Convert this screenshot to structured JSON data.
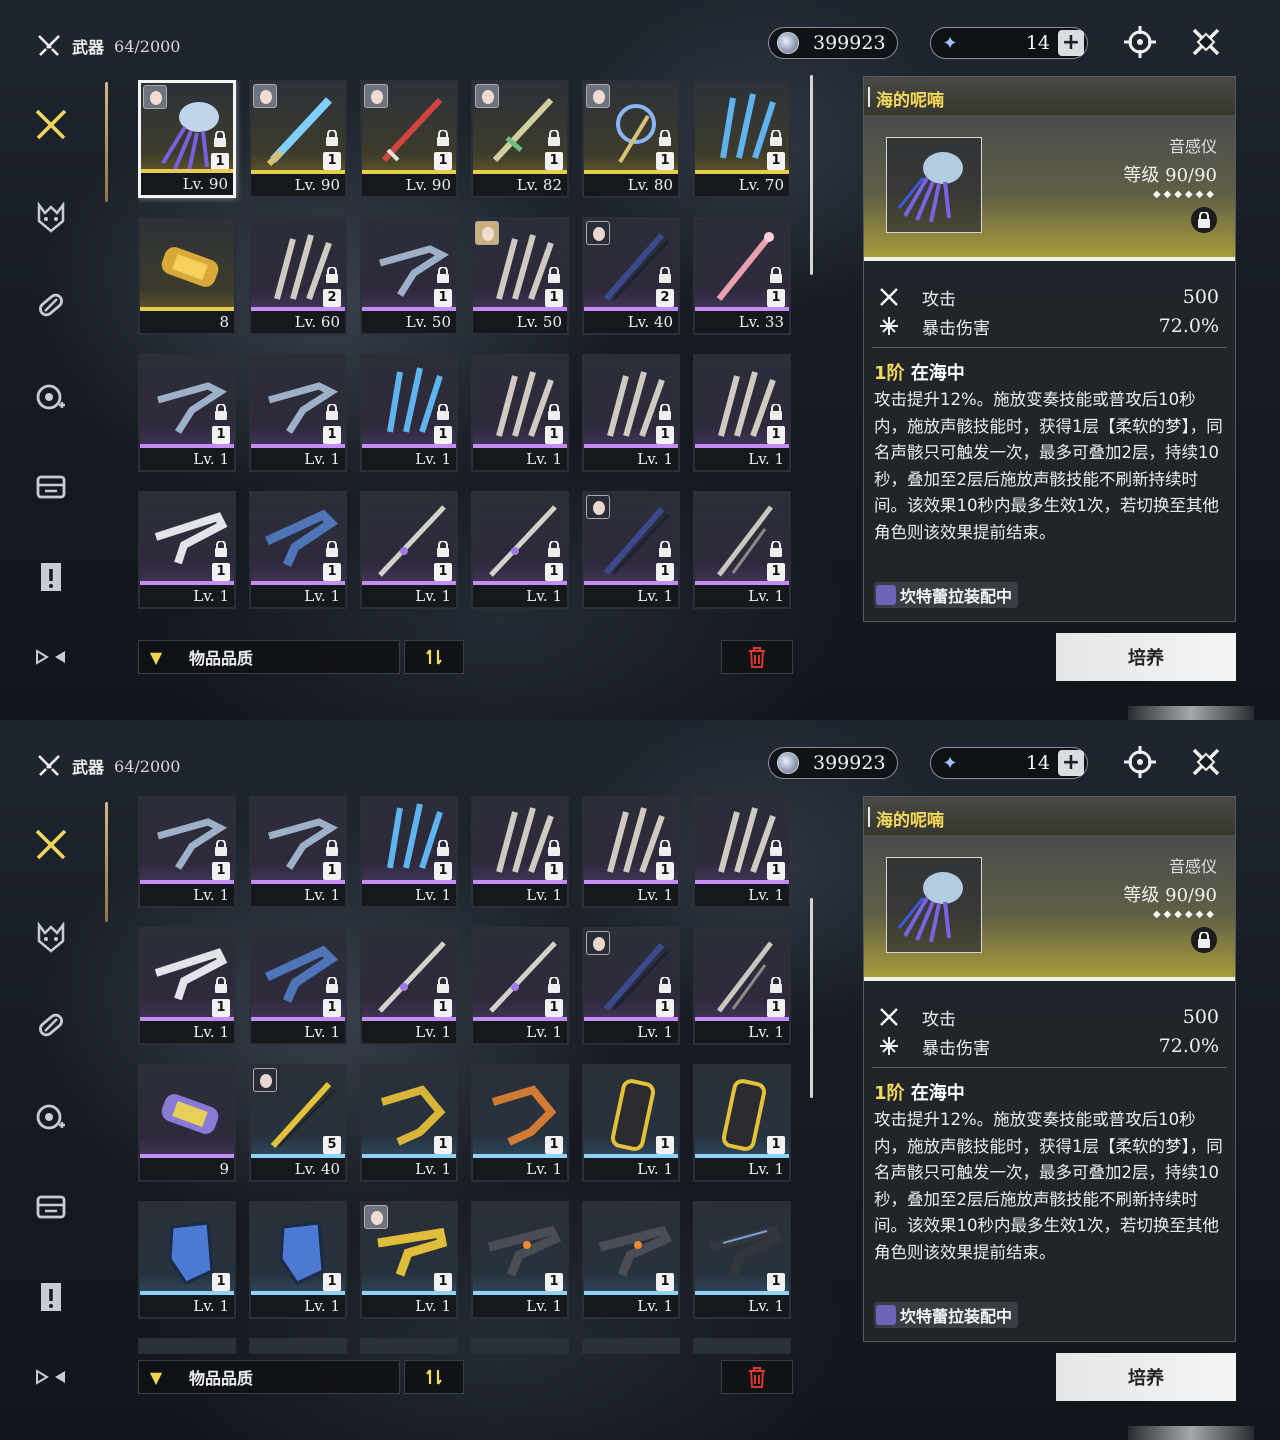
{
  "header": {
    "title": "武器",
    "count": "64/2000",
    "currency_shell": "399923",
    "currency_tide": "14"
  },
  "filter": {
    "label": "物品品质"
  },
  "detail": {
    "name": "海的呢喃",
    "type": "音感仪",
    "level_label": "等级",
    "level_value": "90/90",
    "stars": "◆◆◆◆◆◆",
    "stats": [
      {
        "label": "攻击",
        "value": "500"
      },
      {
        "label": "暴击伤害",
        "value": "72.0%"
      }
    ],
    "skill_rank": "1阶",
    "skill_name": "在海中",
    "skill_desc": "攻击提升12%。施放变奏技能或普攻后10秒内，施放声骸技能时，获得1层【柔软的梦】，同名声骸只可触发一次，最多可叠加2层，持续10秒，叠加至2层后施放声骸技能不刷新持续时间。该效果10秒内最多生效1次，若切换至其他角色则该效果提前结束。",
    "equipped": "坎特蕾拉装配中",
    "cultivate_label": "培养"
  },
  "colors": {
    "gold": "#e7cc52",
    "purple": "#c68cf5",
    "blue": "#8fd3f8",
    "accent_yellow": "#f4d85c"
  },
  "sidebar_icons": [
    "weapon-icon",
    "echo-icon",
    "material-icon",
    "development-icon",
    "resource-icon",
    "quest-item-icon",
    "special-icon"
  ],
  "screen1_rows": [
    [
      {
        "lv": "Lv. 90",
        "count": "1",
        "rarity": "gold",
        "art": "jellyfish",
        "owner": "purple",
        "locked": true,
        "selected": true
      },
      {
        "lv": "Lv. 90",
        "count": "1",
        "rarity": "gold",
        "art": "sword-blue",
        "owner": "silver",
        "locked": true
      },
      {
        "lv": "Lv. 90",
        "count": "1",
        "rarity": "gold",
        "art": "sword-red",
        "owner": "silver",
        "locked": true
      },
      {
        "lv": "Lv. 82",
        "count": "1",
        "rarity": "gold",
        "art": "sword-green",
        "owner": "silver",
        "locked": true
      },
      {
        "lv": "Lv. 80",
        "count": "1",
        "rarity": "gold",
        "art": "staff-blue",
        "owner": "silver",
        "locked": true
      },
      {
        "lv": "Lv. 70",
        "count": "1",
        "rarity": "gold",
        "art": "claw-blue",
        "locked": true
      }
    ],
    [
      {
        "lv": "8",
        "rarity": "gold",
        "art": "canister-gold"
      },
      {
        "lv": "Lv. 60",
        "count": "2",
        "rarity": "purple",
        "art": "blades-silver",
        "locked": true
      },
      {
        "lv": "Lv. 50",
        "count": "1",
        "rarity": "purple",
        "art": "gun-dark",
        "locked": true
      },
      {
        "lv": "Lv. 50",
        "count": "1",
        "rarity": "purple",
        "art": "blades-silver",
        "owner": "blonde",
        "locked": true
      },
      {
        "lv": "Lv. 40",
        "count": "2",
        "rarity": "purple",
        "art": "sword-dark",
        "owner": "dark",
        "locked": true
      },
      {
        "lv": "Lv. 33",
        "count": "1",
        "rarity": "purple",
        "art": "sword-pink",
        "locked": true
      }
    ],
    [
      {
        "lv": "Lv. 1",
        "count": "1",
        "rarity": "purple",
        "art": "gun-dark",
        "locked": true
      },
      {
        "lv": "Lv. 1",
        "count": "1",
        "rarity": "purple",
        "art": "gun-dark",
        "locked": true
      },
      {
        "lv": "Lv. 1",
        "count": "1",
        "rarity": "purple",
        "art": "claw-blue",
        "locked": true
      },
      {
        "lv": "Lv. 1",
        "count": "1",
        "rarity": "purple",
        "art": "blades-silver",
        "locked": true
      },
      {
        "lv": "Lv. 1",
        "count": "1",
        "rarity": "purple",
        "art": "blades-silver",
        "locked": true
      },
      {
        "lv": "Lv. 1",
        "count": "1",
        "rarity": "purple",
        "art": "blades-silver",
        "locked": true
      }
    ],
    [
      {
        "lv": "Lv. 1",
        "count": "1",
        "rarity": "purple",
        "art": "pistol-white",
        "locked": true
      },
      {
        "lv": "Lv. 1",
        "count": "1",
        "rarity": "purple",
        "art": "pistol-blue",
        "locked": true
      },
      {
        "lv": "Lv. 1",
        "count": "1",
        "rarity": "purple",
        "art": "sword-long",
        "locked": true
      },
      {
        "lv": "Lv. 1",
        "count": "1",
        "rarity": "purple",
        "art": "sword-long",
        "locked": true
      },
      {
        "lv": "Lv. 1",
        "count": "1",
        "rarity": "purple",
        "art": "sword-dark",
        "owner": "dark",
        "locked": true
      },
      {
        "lv": "Lv. 1",
        "count": "1",
        "rarity": "purple",
        "art": "spear",
        "locked": true
      }
    ]
  ],
  "screen2_rows": [
    [
      {
        "lv": "Lv. 1",
        "count": "1",
        "rarity": "purple",
        "art": "gun-dark",
        "locked": true
      },
      {
        "lv": "Lv. 1",
        "count": "1",
        "rarity": "purple",
        "art": "gun-dark",
        "locked": true
      },
      {
        "lv": "Lv. 1",
        "count": "1",
        "rarity": "purple",
        "art": "claw-blue",
        "locked": true
      },
      {
        "lv": "Lv. 1",
        "count": "1",
        "rarity": "purple",
        "art": "blades-silver",
        "locked": true
      },
      {
        "lv": "Lv. 1",
        "count": "1",
        "rarity": "purple",
        "art": "blades-silver",
        "locked": true
      },
      {
        "lv": "Lv. 1",
        "count": "1",
        "rarity": "purple",
        "art": "blades-silver",
        "locked": true
      }
    ],
    [
      {
        "lv": "Lv. 1",
        "count": "1",
        "rarity": "purple",
        "art": "pistol-white",
        "locked": true
      },
      {
        "lv": "Lv. 1",
        "count": "1",
        "rarity": "purple",
        "art": "pistol-blue",
        "locked": true
      },
      {
        "lv": "Lv. 1",
        "count": "1",
        "rarity": "purple",
        "art": "sword-long",
        "locked": true
      },
      {
        "lv": "Lv. 1",
        "count": "1",
        "rarity": "purple",
        "art": "sword-long",
        "locked": true
      },
      {
        "lv": "Lv. 1",
        "count": "1",
        "rarity": "purple",
        "art": "sword-dark",
        "owner": "dark",
        "locked": true
      },
      {
        "lv": "Lv. 1",
        "count": "1",
        "rarity": "purple",
        "art": "spear",
        "locked": true
      }
    ],
    [
      {
        "lv": "9",
        "rarity": "purple",
        "art": "canister-purple"
      },
      {
        "lv": "Lv. 40",
        "count": "5",
        "rarity": "blue",
        "art": "sword-gold",
        "owner": "dark"
      },
      {
        "lv": "Lv. 1",
        "count": "1",
        "rarity": "blue",
        "art": "gun-gold"
      },
      {
        "lv": "Lv. 1",
        "count": "1",
        "rarity": "blue",
        "art": "gun-orange"
      },
      {
        "lv": "Lv. 1",
        "count": "1",
        "rarity": "blue",
        "art": "gauntlet-gold"
      },
      {
        "lv": "Lv. 1",
        "count": "1",
        "rarity": "blue",
        "art": "gauntlet-gold"
      }
    ],
    [
      {
        "lv": "Lv. 1",
        "count": "1",
        "rarity": "blue",
        "art": "gauntlet-blue"
      },
      {
        "lv": "Lv. 1",
        "count": "1",
        "rarity": "blue",
        "art": "gauntlet-blue"
      },
      {
        "lv": "Lv. 1",
        "count": "1",
        "rarity": "blue",
        "art": "pistol-gold",
        "owner": "silver"
      },
      {
        "lv": "Lv. 1",
        "count": "1",
        "rarity": "blue",
        "art": "pistol-orange"
      },
      {
        "lv": "Lv. 1",
        "count": "1",
        "rarity": "blue",
        "art": "pistol-orange"
      },
      {
        "lv": "Lv. 1",
        "count": "1",
        "rarity": "blue",
        "art": "pistol-dark"
      }
    ],
    [
      {
        "lv": "",
        "rarity": "none",
        "art": "none"
      },
      {
        "lv": "",
        "rarity": "none",
        "art": "none"
      },
      {
        "lv": "",
        "rarity": "none",
        "art": "none"
      },
      {
        "lv": "",
        "rarity": "none",
        "art": "none"
      },
      {
        "lv": "",
        "rarity": "none",
        "art": "none"
      },
      {
        "lv": "",
        "rarity": "none",
        "art": "none"
      }
    ]
  ]
}
